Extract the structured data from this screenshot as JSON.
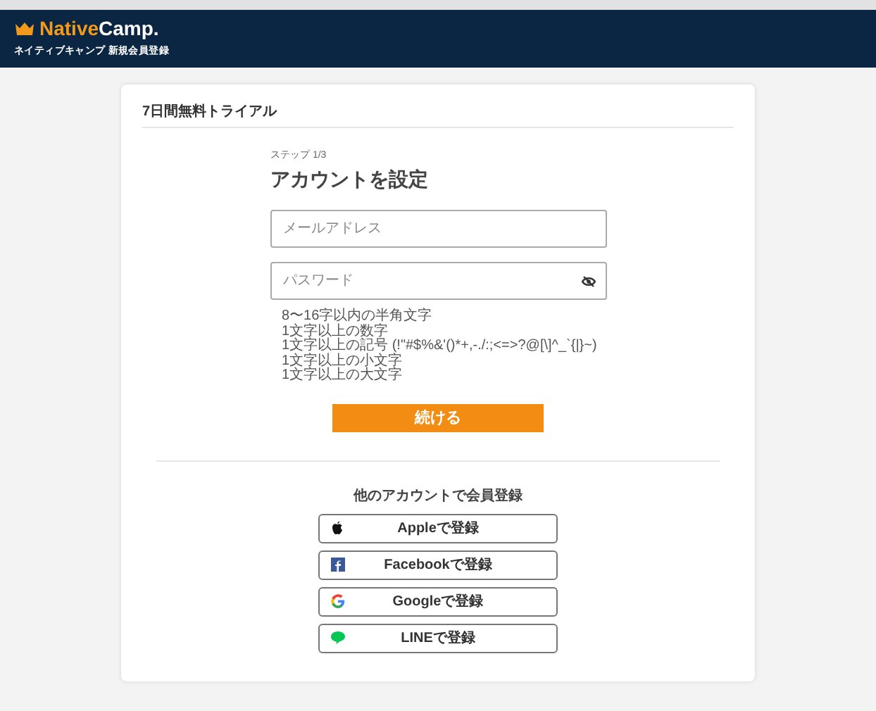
{
  "header": {
    "logo": {
      "brand_first": "Native",
      "brand_second": "Camp."
    },
    "subtitle": "ネイティブキャンプ 新規会員登録"
  },
  "card": {
    "title": "7日間無料トライアル",
    "step": "ステップ 1/3",
    "heading": "アカウントを設定",
    "email_field": {
      "placeholder": "メールアドレス"
    },
    "password_field": {
      "placeholder": "パスワード"
    },
    "password_rules": [
      "8〜16字以内の半角文字",
      "1文字以上の数字",
      "1文字以上の記号 (!\"#$%&'()*+,-./:;<=>?@[\\]^_`{|}~)",
      "1文字以上の小文字",
      "1文字以上の大文字"
    ],
    "continue_button": "続ける",
    "social_heading": "他のアカウントで会員登録",
    "social_buttons": [
      {
        "kind": "apple",
        "label": "Appleで登録"
      },
      {
        "kind": "facebook",
        "label": "Facebookで登録"
      },
      {
        "kind": "google",
        "label": "Googleで登録"
      },
      {
        "kind": "line",
        "label": "LINEで登録"
      }
    ]
  }
}
